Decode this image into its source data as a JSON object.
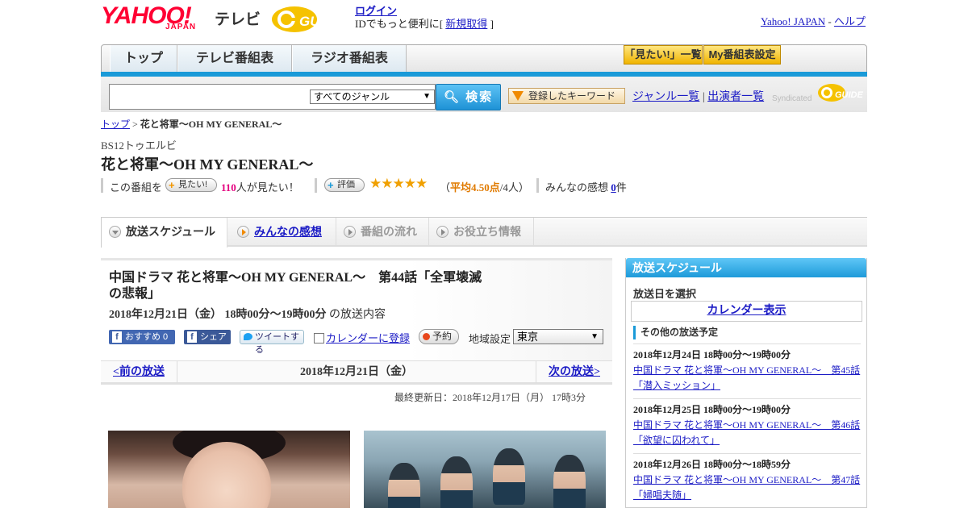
{
  "header": {
    "yahoo_logo_text": "YAHOO!",
    "yahoo_logo_sub": "JAPAN",
    "tv_label": "テレビ",
    "gguide_logo_text": "G-GUIDE",
    "login_link": "ログイン",
    "login_prompt_before": "IDでもっと便利に[",
    "signup_link": "新規取得",
    "login_prompt_after": "]",
    "yahoo_japan_link": "Yahoo! JAPAN",
    "link_separator": "-",
    "help_link": "ヘルプ"
  },
  "nav": {
    "tabs": [
      {
        "label": "トップ"
      },
      {
        "label": "テレビ番組表"
      },
      {
        "label": "ラジオ番組表"
      }
    ],
    "want_list_button": "「見たい!」一覧",
    "my_program_button": "My番組表設定"
  },
  "search": {
    "input_value": "",
    "genre_selected": "すべてのジャンル",
    "search_button": "検索",
    "keyword_button": "登録したキーワード",
    "genre_list_link": "ジャンル一覧",
    "separator": "|",
    "performer_list_link": "出演者一覧",
    "syndicated_text": "Syndicated",
    "syndicated_logo_text": "G-GUIDE"
  },
  "breadcrumb": {
    "home": "トップ",
    "separator": ">",
    "current": "花と将軍～OH MY GENERAL～"
  },
  "program": {
    "channel": "BS12トゥエルビ",
    "title": "花と将軍～OH MY GENERAL～",
    "want_prefix": "この番組を",
    "want_button": "見たい!",
    "want_count": "110",
    "want_suffix": "人が見たい！",
    "rate_button": "評価",
    "stars": "★★★★★",
    "rating_open": "（",
    "rating_avg": "平均4.50点",
    "rating_people": "/4人）",
    "impressions_label": "みんなの感想",
    "impressions_count": "0",
    "impressions_unit": "件"
  },
  "content_tabs": [
    {
      "label": "放送スケジュール",
      "active": true
    },
    {
      "label": "みんなの感想",
      "active": false
    },
    {
      "label": "番組の流れ",
      "active": false
    },
    {
      "label": "お役立ち情報",
      "active": false
    }
  ],
  "episode": {
    "title": "中国ドラマ 花と将軍～OH MY GENERAL～　第44話「全軍壊滅の悲報」",
    "datetime": "2018年12月21日（金）  18時00分～19時00分",
    "datetime_suffix": " の放送内容",
    "fb_recommend": "おすすめ 0",
    "fb_share": "シェア",
    "tweet": "ツイートする",
    "calendar_register": "カレンダーに登録",
    "reserve": "予約",
    "region_label": "地域設定",
    "region_value": "東京"
  },
  "pager": {
    "prev": "<前の放送",
    "current": "2018年12月21日（金）",
    "next": "次の放送>"
  },
  "updated": "最終更新日：2018年12月17日（月）  17時3分",
  "sidebar": {
    "heading": "放送スケジュール",
    "pick_date": "放送日を選択",
    "calendar_link": "カレンダー表示",
    "other_heading": "その他の放送予定",
    "schedules": [
      {
        "date": "2018年12月24日  18時00分～19時00分",
        "title": "中国ドラマ 花と将軍～OH MY GENERAL～　第45話「潜入ミッション」"
      },
      {
        "date": "2018年12月25日  18時00分～19時00分",
        "title": "中国ドラマ 花と将軍～OH MY GENERAL～　第46話「欲望に囚われて」"
      },
      {
        "date": "2018年12月26日  18時00分～18時59分",
        "title": "中国ドラマ 花と将軍～OH MY GENERAL～　第47話「婦唱夫随」"
      }
    ]
  },
  "colors": {
    "accent_blue": "#1a9ad8",
    "yahoo_red": "#ff0033",
    "star_orange": "#f0a000",
    "link": "#1b1bc5"
  }
}
